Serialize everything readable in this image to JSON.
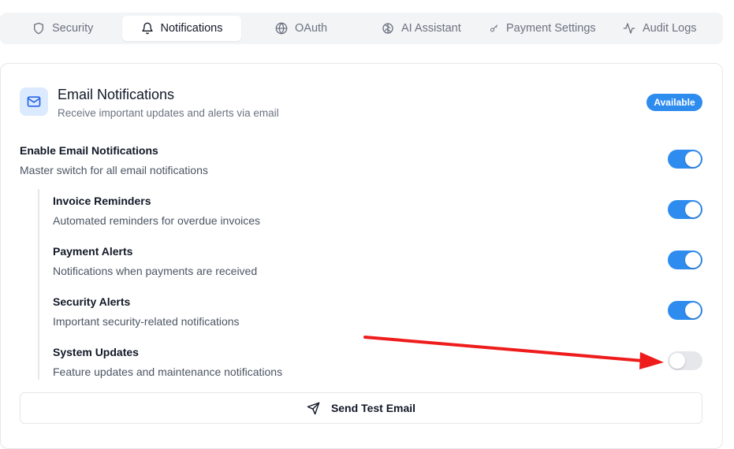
{
  "tabs": [
    {
      "label": "Security",
      "icon": "shield-icon",
      "active": false
    },
    {
      "label": "Notifications",
      "icon": "bell-icon",
      "active": true
    },
    {
      "label": "OAuth",
      "icon": "globe-icon",
      "active": false
    },
    {
      "label": "AI Assistant",
      "icon": "brain-icon",
      "active": false
    },
    {
      "label": "Payment Settings",
      "icon": "key-icon",
      "active": false
    },
    {
      "label": "Audit Logs",
      "icon": "activity-icon",
      "active": false
    }
  ],
  "card": {
    "icon": "mail-icon",
    "title": "Email Notifications",
    "subtitle": "Receive important updates and alerts via email",
    "badge": "Available"
  },
  "master": {
    "title": "Enable Email Notifications",
    "desc": "Master switch for all email notifications",
    "enabled": true
  },
  "options": [
    {
      "title": "Invoice Reminders",
      "desc": "Automated reminders for overdue invoices",
      "enabled": true
    },
    {
      "title": "Payment Alerts",
      "desc": "Notifications when payments are received",
      "enabled": true
    },
    {
      "title": "Security Alerts",
      "desc": "Important security-related notifications",
      "enabled": true
    },
    {
      "title": "System Updates",
      "desc": "Feature updates and maintenance notifications",
      "enabled": false
    }
  ],
  "send_button": {
    "label": "Send Test Email",
    "icon": "send-icon"
  },
  "colors": {
    "accent": "#2f8cef",
    "annotation_arrow": "#ef1c1c"
  }
}
